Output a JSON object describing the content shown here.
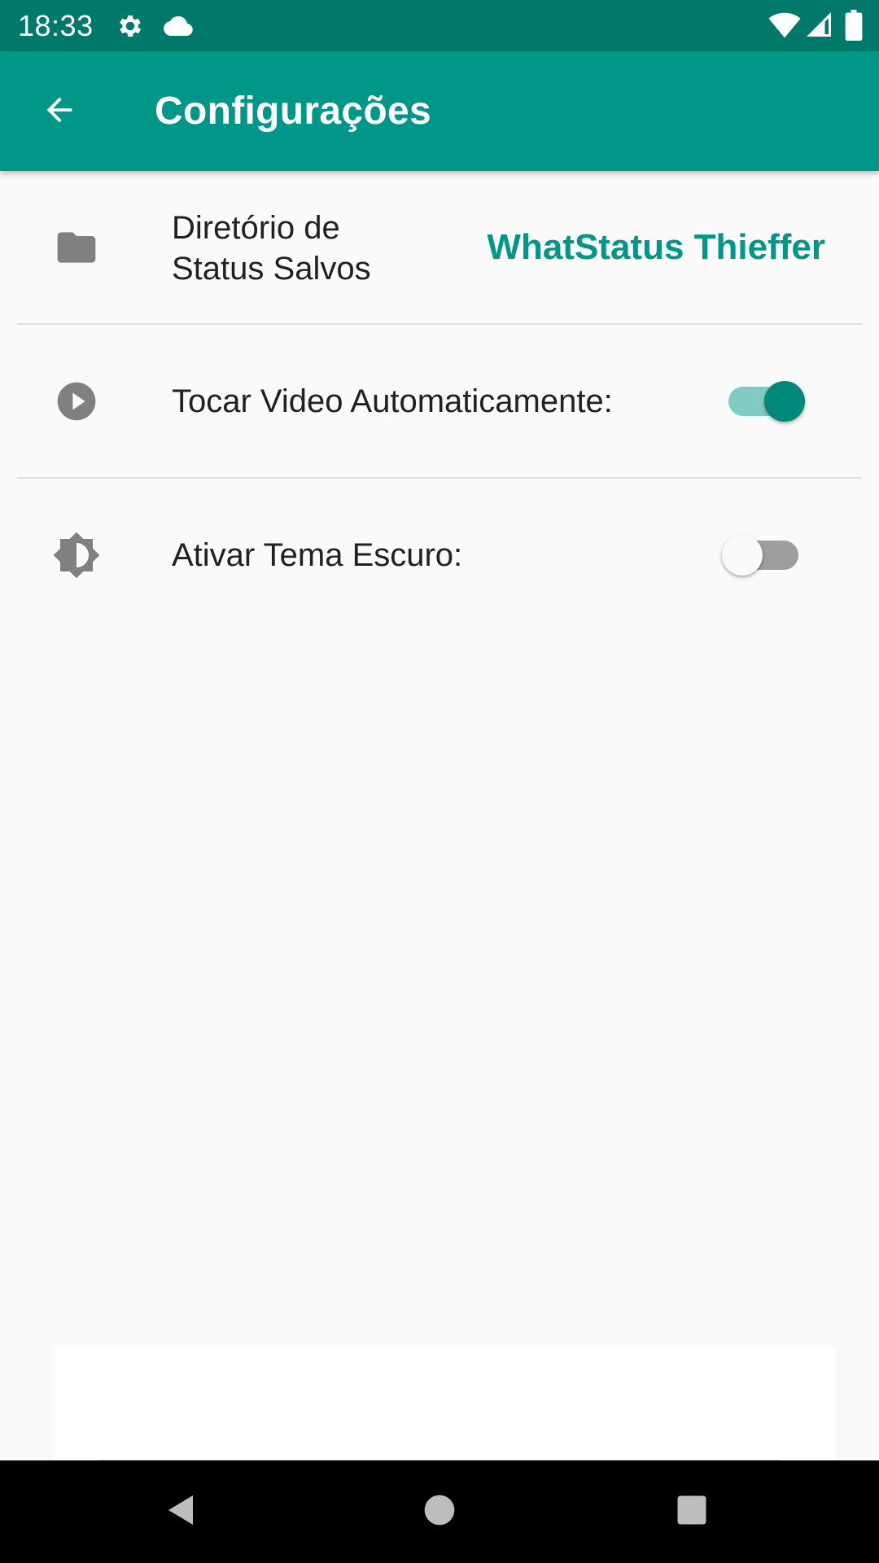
{
  "status_bar": {
    "time": "18:33",
    "icons": [
      "gear-icon",
      "cloud-icon",
      "wifi-icon",
      "signal-icon",
      "battery-icon"
    ]
  },
  "app_bar": {
    "title": "Configurações",
    "back_icon": "arrow-back-icon",
    "background": "#009688"
  },
  "settings": {
    "items": [
      {
        "icon": "folder-icon",
        "label": "Diretório de Status Salvos",
        "value": "WhatStatus Thieffer"
      },
      {
        "icon": "play-circle-icon",
        "label": "Tocar Video Automaticamente:",
        "switch_on": true
      },
      {
        "icon": "brightness-icon",
        "label": "Ativar Tema Escuro:",
        "switch_on": false
      }
    ]
  },
  "colors": {
    "accent": "#009688",
    "status_bar": "#00796b",
    "background": "#fafafa"
  },
  "nav_bar": {
    "buttons": [
      "back-triangle-icon",
      "home-circle-icon",
      "recents-square-icon"
    ]
  }
}
